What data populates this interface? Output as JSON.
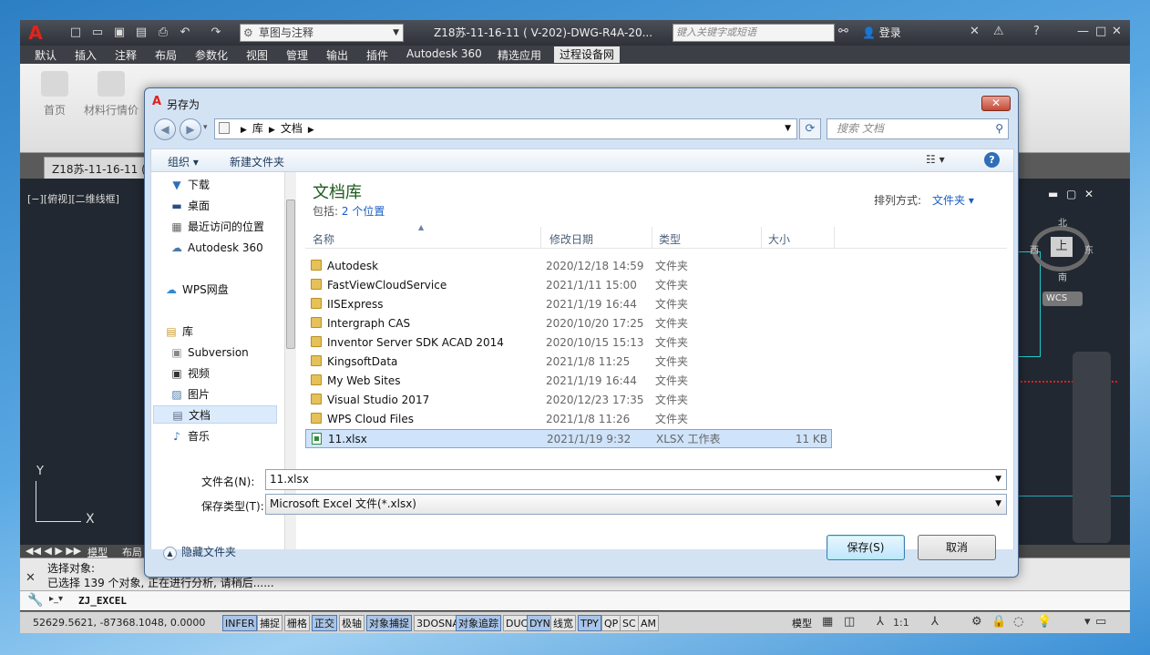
{
  "cad": {
    "title": "Z18苏-11-16-11 ( V-202)-DWG-R4A-20...",
    "workspace": "草图与注释",
    "keyword_search_placeholder": "键入关键字或短语",
    "login": "登录",
    "menus": [
      "默认",
      "插入",
      "注释",
      "布局",
      "参数化",
      "视图",
      "管理",
      "输出",
      "插件",
      "Autodesk 360",
      "精选应用",
      "过程设备网"
    ],
    "ribbon_buttons": [
      "首页",
      "材料行情价"
    ],
    "doc_tab": "Z18苏-11-16-11 (",
    "viewport_label": "[−][俯视][二维线框]",
    "ucs_y": "Y",
    "ucs_x": "X",
    "viewcube": {
      "n": "北",
      "s": "南",
      "e": "东",
      "w": "西",
      "top": "上",
      "wcs": "WCS"
    },
    "layout_tabs": [
      "模型",
      "布局"
    ],
    "cmd_history": [
      "选择对象:",
      "已选择 139 个对象, 正在进行分析, 请稍后......"
    ],
    "cmd_input": "ZJ_EXCEL",
    "coords": "52629.5621, -87368.1048, 0.0000",
    "status_toggles": [
      {
        "label": "INFER",
        "on": true
      },
      {
        "label": "捕捉",
        "on": false
      },
      {
        "label": "栅格",
        "on": false
      },
      {
        "label": "正交",
        "on": true
      },
      {
        "label": "极轴",
        "on": false
      },
      {
        "label": "对象捕捉",
        "on": true
      },
      {
        "label": "3DOSNAP",
        "on": false
      },
      {
        "label": "对象追踪",
        "on": true
      },
      {
        "label": "DUCS",
        "on": false
      },
      {
        "label": "DYN",
        "on": true
      },
      {
        "label": "线宽",
        "on": false
      },
      {
        "label": "TPY",
        "on": true
      },
      {
        "label": "QP",
        "on": false
      },
      {
        "label": "SC",
        "on": false
      },
      {
        "label": "AM",
        "on": false
      }
    ],
    "status_model": "模型",
    "status_scale": "1:1"
  },
  "dialog": {
    "title": "另存为",
    "breadcrumb": [
      "库",
      "文档"
    ],
    "search_placeholder": "搜索 文档",
    "organize": "组织 ▾",
    "new_folder": "新建文件夹",
    "nav_items": [
      {
        "label": "下载",
        "icon": "download"
      },
      {
        "label": "桌面",
        "icon": "desktop"
      },
      {
        "label": "最近访问的位置",
        "icon": "recent"
      },
      {
        "label": "Autodesk 360",
        "icon": "cloud"
      },
      {
        "label": "WPS网盘",
        "icon": "cloud"
      },
      {
        "label": "库",
        "icon": "library"
      },
      {
        "label": "Subversion",
        "icon": "folder"
      },
      {
        "label": "视频",
        "icon": "video"
      },
      {
        "label": "图片",
        "icon": "picture"
      },
      {
        "label": "文档",
        "icon": "document"
      },
      {
        "label": "音乐",
        "icon": "music"
      }
    ],
    "library_title": "文档库",
    "includes_label": "包括:",
    "includes_link": "2 个位置",
    "sort_label": "排列方式:",
    "sort_value": "文件夹 ▾",
    "columns": [
      "名称",
      "修改日期",
      "类型",
      "大小"
    ],
    "files": [
      {
        "name": "Autodesk",
        "date": "2020/12/18 14:59",
        "type": "文件夹",
        "size": ""
      },
      {
        "name": "FastViewCloudService",
        "date": "2021/1/11 15:00",
        "type": "文件夹",
        "size": ""
      },
      {
        "name": "IISExpress",
        "date": "2021/1/19 16:44",
        "type": "文件夹",
        "size": ""
      },
      {
        "name": "Intergraph CAS",
        "date": "2020/10/20 17:25",
        "type": "文件夹",
        "size": ""
      },
      {
        "name": "Inventor Server SDK ACAD 2014",
        "date": "2020/10/15 15:13",
        "type": "文件夹",
        "size": ""
      },
      {
        "name": "KingsoftData",
        "date": "2021/1/8 11:25",
        "type": "文件夹",
        "size": ""
      },
      {
        "name": "My Web Sites",
        "date": "2021/1/19 16:44",
        "type": "文件夹",
        "size": ""
      },
      {
        "name": "Visual Studio 2017",
        "date": "2020/12/23 17:35",
        "type": "文件夹",
        "size": ""
      },
      {
        "name": "WPS Cloud Files",
        "date": "2021/1/8 11:26",
        "type": "文件夹",
        "size": ""
      },
      {
        "name": "11.xlsx",
        "date": "2021/1/19 9:32",
        "type": "XLSX 工作表",
        "size": "11 KB"
      }
    ],
    "filename_label": "文件名(N):",
    "filename_value": "11.xlsx",
    "filetype_label": "保存类型(T):",
    "filetype_value": "Microsoft Excel 文件(*.xlsx)",
    "hide_folders": "隐藏文件夹",
    "save_label": "保存(S)",
    "cancel_label": "取消"
  }
}
